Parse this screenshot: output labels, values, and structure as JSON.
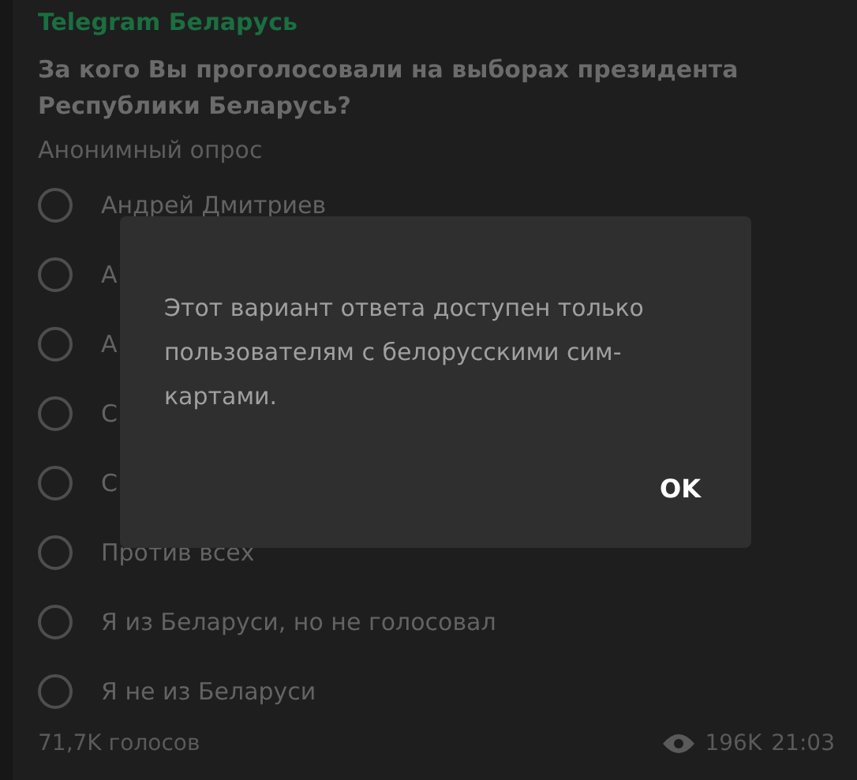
{
  "channel": {
    "name": "Telegram Беларусь"
  },
  "poll": {
    "question": "За кого Вы проголосовали на выборах президента Республики Беларусь?",
    "type": "Анонимный опрос",
    "options": [
      {
        "label": "Андрей Дмитриев",
        "selected": false
      },
      {
        "label": "А",
        "selected": false
      },
      {
        "label": "А",
        "selected": false
      },
      {
        "label": "С",
        "selected": false
      },
      {
        "label": "С",
        "selected": false
      },
      {
        "label": "Против всех",
        "selected": false
      },
      {
        "label": "Я из Беларуси, но не голосовал",
        "selected": false
      },
      {
        "label": "Я не из Беларуси",
        "selected": false
      }
    ],
    "votes": "71,7K голосов",
    "views": "196K",
    "time": "21:03"
  },
  "dialog": {
    "message": "Этот вариант ответа доступен только пользователям с белорусскими сим-картами.",
    "button": "OK"
  }
}
